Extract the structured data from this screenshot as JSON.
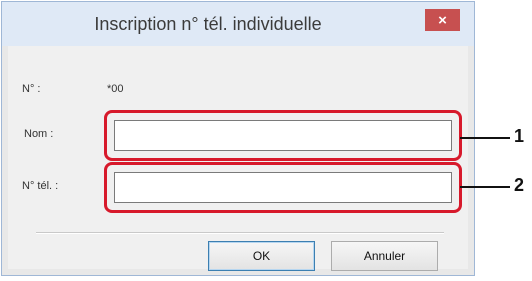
{
  "dialog": {
    "title": "Inscription n° tél. individuelle",
    "close_label": "×",
    "number_label": "N° :",
    "number_value": "*00",
    "name_label": "Nom :",
    "name_value": "",
    "phone_label": "N° tél. :",
    "phone_value": "",
    "ok_label": "OK",
    "cancel_label": "Annuler"
  },
  "callouts": [
    "1",
    "2"
  ],
  "colors": {
    "highlight": "#d7192b",
    "close": "#c75050",
    "titlebar": "#dfe9f6"
  }
}
